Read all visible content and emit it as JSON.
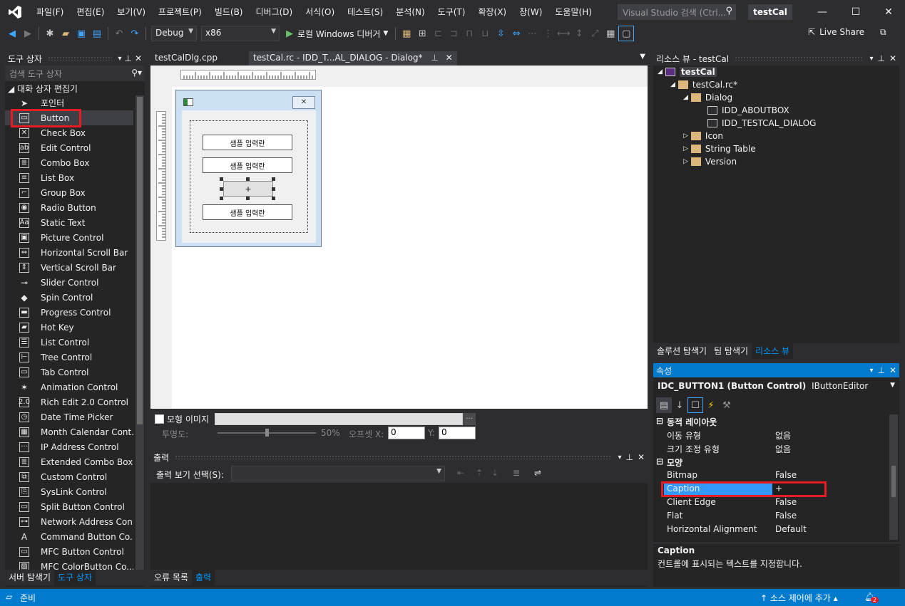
{
  "menubar": {
    "items": [
      "파일(F)",
      "편집(E)",
      "보기(V)",
      "프로젝트(P)",
      "빌드(B)",
      "디버그(D)",
      "서식(O)",
      "테스트(S)",
      "분석(N)",
      "도구(T)",
      "확장(X)",
      "창(W)",
      "도움말(H)"
    ],
    "search_placeholder": "Visual Studio 검색 (Ctrl...",
    "project_title": "testCal"
  },
  "toolbar": {
    "config": "Debug",
    "platform": "x86",
    "run_label": "로컬 Windows 디버거",
    "live_share": "Live Share"
  },
  "toolbox": {
    "title": "도구 상자",
    "search_placeholder": "검색 도구 상자",
    "group": "대화 상자 편집기",
    "items": [
      {
        "label": "포인터",
        "icon": "pointer-icon",
        "glyph": "➤"
      },
      {
        "label": "Button",
        "icon": "button-icon",
        "glyph": "▭"
      },
      {
        "label": "Check Box",
        "icon": "checkbox-icon",
        "glyph": "✕"
      },
      {
        "label": "Edit Control",
        "icon": "edit-control-icon",
        "glyph": "ab"
      },
      {
        "label": "Combo Box",
        "icon": "combo-box-icon",
        "glyph": "≣"
      },
      {
        "label": "List Box",
        "icon": "list-box-icon",
        "glyph": "≡"
      },
      {
        "label": "Group Box",
        "icon": "group-box-icon",
        "glyph": "⌐"
      },
      {
        "label": "Radio Button",
        "icon": "radio-button-icon",
        "glyph": "◉"
      },
      {
        "label": "Static Text",
        "icon": "static-text-icon",
        "glyph": "Aa"
      },
      {
        "label": "Picture Control",
        "icon": "picture-control-icon",
        "glyph": "▣"
      },
      {
        "label": "Horizontal Scroll Bar",
        "icon": "hscroll-icon",
        "glyph": "⇔"
      },
      {
        "label": "Vertical Scroll Bar",
        "icon": "vscroll-icon",
        "glyph": "⇕"
      },
      {
        "label": "Slider Control",
        "icon": "slider-icon",
        "glyph": "⊸"
      },
      {
        "label": "Spin Control",
        "icon": "spin-icon",
        "glyph": "◆"
      },
      {
        "label": "Progress Control",
        "icon": "progress-icon",
        "glyph": "▬"
      },
      {
        "label": "Hot Key",
        "icon": "hotkey-icon",
        "glyph": "▰"
      },
      {
        "label": "List Control",
        "icon": "list-control-icon",
        "glyph": "☰"
      },
      {
        "label": "Tree Control",
        "icon": "tree-control-icon",
        "glyph": "⊢"
      },
      {
        "label": "Tab Control",
        "icon": "tab-control-icon",
        "glyph": "▭"
      },
      {
        "label": "Animation Control",
        "icon": "animation-icon",
        "glyph": "✶"
      },
      {
        "label": "Rich Edit 2.0 Control",
        "icon": "rich-edit-icon",
        "glyph": "2.0"
      },
      {
        "label": "Date Time Picker",
        "icon": "datetime-icon",
        "glyph": "◷"
      },
      {
        "label": "Month Calendar Cont...",
        "icon": "calendar-icon",
        "glyph": "▦"
      },
      {
        "label": "IP Address Control",
        "icon": "ip-address-icon",
        "glyph": "···"
      },
      {
        "label": "Extended Combo Box",
        "icon": "ext-combo-icon",
        "glyph": "≣"
      },
      {
        "label": "Custom Control",
        "icon": "custom-control-icon",
        "glyph": "⧉"
      },
      {
        "label": "SysLink Control",
        "icon": "syslink-icon",
        "glyph": "⎘"
      },
      {
        "label": "Split Button Control",
        "icon": "split-button-icon",
        "glyph": "▭"
      },
      {
        "label": "Network Address Con...",
        "icon": "network-address-icon",
        "glyph": "⊶"
      },
      {
        "label": "Command Button Co...",
        "icon": "command-button-icon",
        "glyph": "A"
      },
      {
        "label": "MFC Button Control",
        "icon": "mfc-button-icon",
        "glyph": "▭"
      },
      {
        "label": "MFC ColorButton Co...",
        "icon": "mfc-color-icon",
        "glyph": "▨"
      }
    ],
    "tab_server": "서버 탐색기",
    "tab_toolbox": "도구 상자"
  },
  "doc_tabs": [
    "testCalDlg.cpp",
    "testCal.rc - IDD_T...AL_DIALOG - Dialog*"
  ],
  "dialog": {
    "button1": "샘플 입력란",
    "button2": "샘플 입력란",
    "selected_button": "+",
    "button3": "샘플 입력란"
  },
  "modebar": {
    "mock_image": "모형 이미지",
    "browse": "...",
    "transparency": "투명도:",
    "percent": "50%",
    "offset": "오프셋 X:",
    "x_val": "0",
    "y_label": "Y:",
    "y_val": "0",
    "transparency_level": 0.5
  },
  "output": {
    "title": "출력",
    "select_label": "출력 보기 선택(S):",
    "tab_errors": "오류 목록",
    "tab_output": "출력"
  },
  "resource_view": {
    "title": "리소스 뷰 - testCal",
    "tree": [
      "testCal",
      "testCal.rc*",
      "Dialog",
      "IDD_ABOUTBOX",
      "IDD_TESTCAL_DIALOG",
      "Icon",
      "String Table",
      "Version"
    ],
    "tabs": [
      "솔루션 탐색기",
      "팀 탐색기",
      "리소스 뷰"
    ]
  },
  "properties": {
    "title": "속성",
    "object": "IDC_BUTTON1 (Button Control)",
    "editor": "IButtonEditor",
    "cat_layout": "동적 레이아웃",
    "rows": [
      {
        "k": "이동 유형",
        "v": "없음"
      },
      {
        "k": "크기 조정 유형",
        "v": "없음"
      }
    ],
    "cat_look": "모양",
    "rows2": [
      {
        "k": "Bitmap",
        "v": "False"
      },
      {
        "k": "Caption",
        "v": "+"
      },
      {
        "k": "Client Edge",
        "v": "False"
      },
      {
        "k": "Flat",
        "v": "False"
      },
      {
        "k": "Horizontal Alignment",
        "v": "Default"
      }
    ],
    "desc_title": "Caption",
    "desc_text": "컨트롤에 표시되는 텍스트를 지정합니다."
  },
  "status": {
    "ready": "준비",
    "source_control": "소스 제어에 추가",
    "notifications": "2"
  },
  "colors": {
    "accent": "#007acc",
    "highlight": "#e51c24",
    "selection": "#3399ff"
  }
}
